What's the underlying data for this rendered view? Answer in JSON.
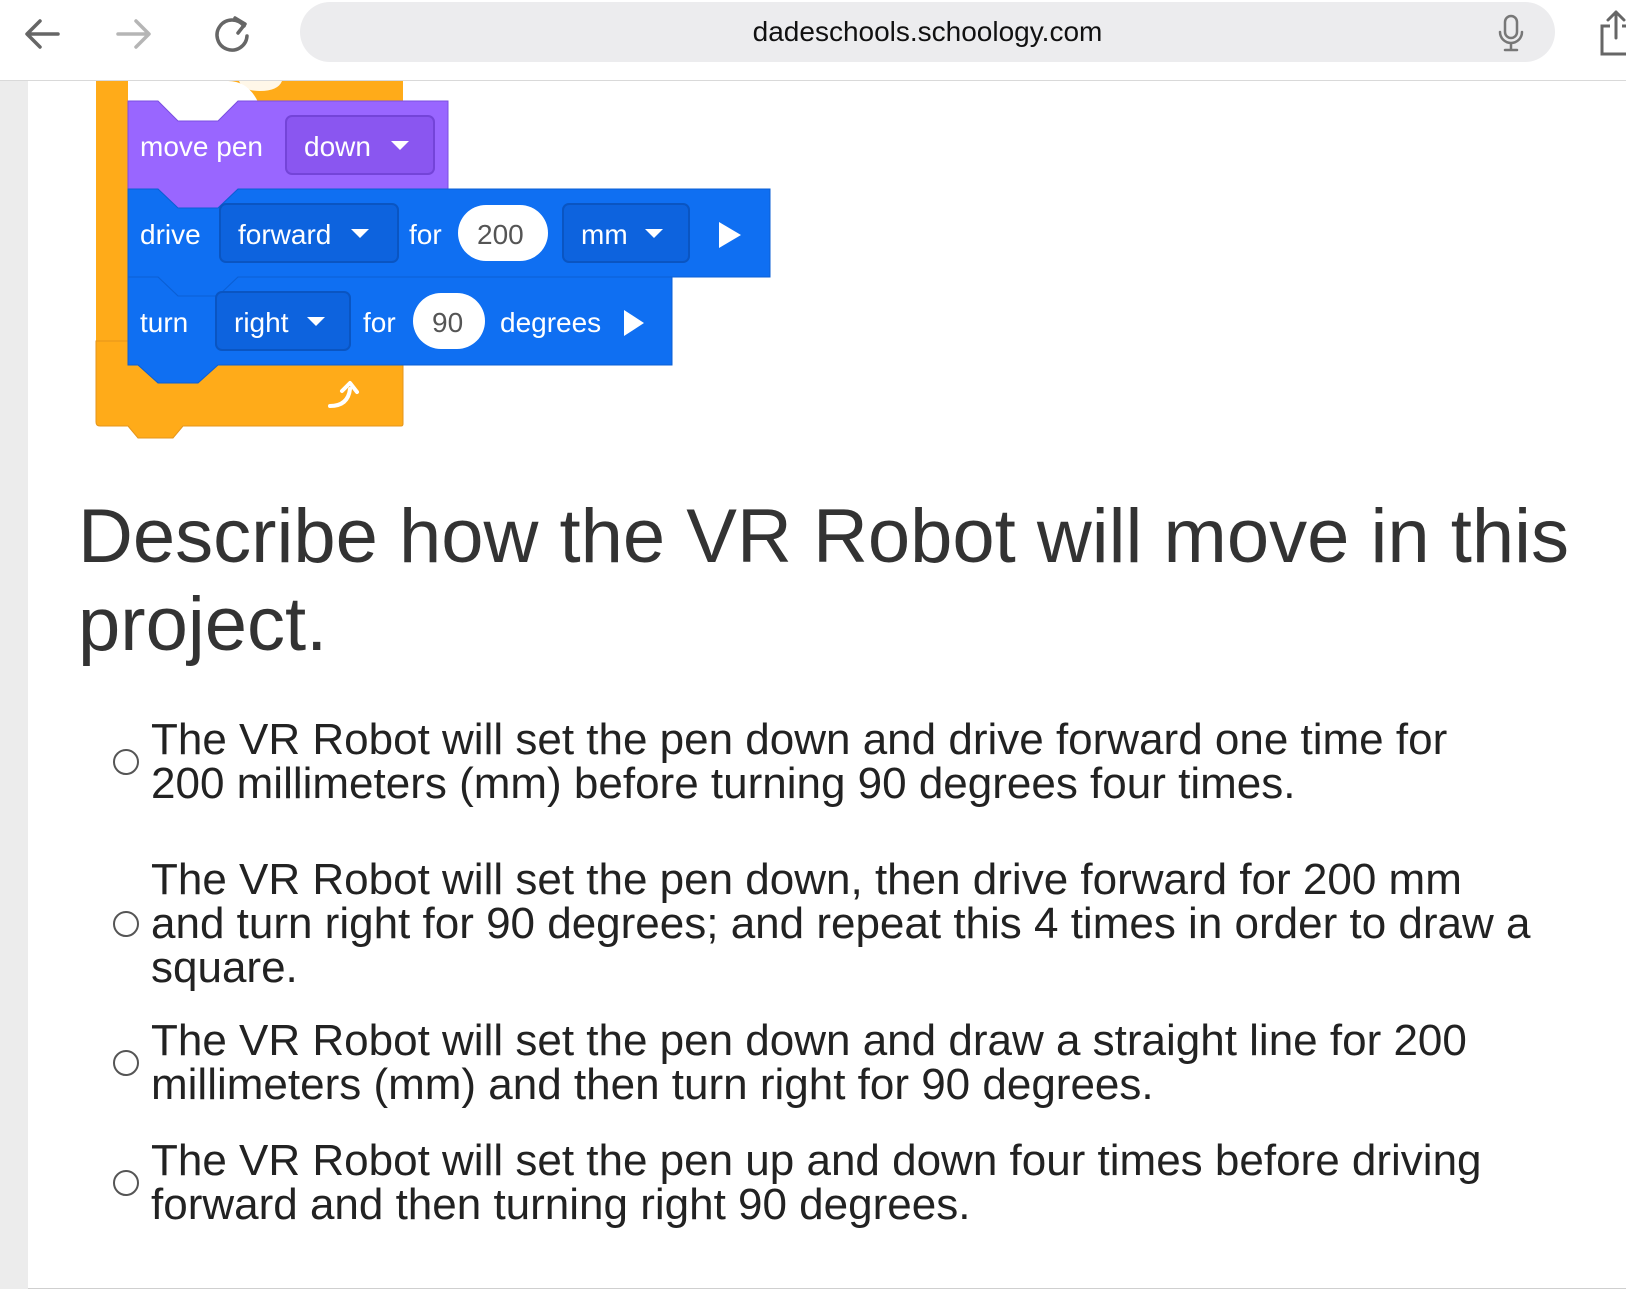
{
  "browser": {
    "url": "dadeschools.schoology.com",
    "icons": [
      "back-arrow-icon",
      "forward-arrow-icon",
      "reload-icon",
      "microphone-icon",
      "share-icon"
    ]
  },
  "blocks": {
    "pen": {
      "label": "move pen",
      "dropdown": "down"
    },
    "drive": {
      "label": "drive",
      "direction": "forward",
      "for_label": "for",
      "value": "200",
      "unit": "mm"
    },
    "turn": {
      "label": "turn",
      "direction": "right",
      "for_label": "for",
      "value": "90",
      "unit": "degrees"
    },
    "colors": {
      "control": "#ffab19",
      "pen": "#9966ff",
      "motion": "#0f6ff2"
    }
  },
  "question": {
    "text": "Describe how the VR Robot will move in this project.",
    "options": [
      "The VR Robot will set the pen down and drive forward one time for 200 millimeters (mm) before turning 90 degrees four times.",
      "The VR Robot will set the pen down, then drive forward for 200 mm and turn right for 90 degrees; and repeat this 4 times in order to draw a square.",
      "The VR Robot will set the pen down and draw a straight line for 200 millimeters (mm) and then turn right for 90 degrees.",
      "The VR Robot will set the pen up and down four times before driving forward and then turning right 90 degrees."
    ]
  }
}
